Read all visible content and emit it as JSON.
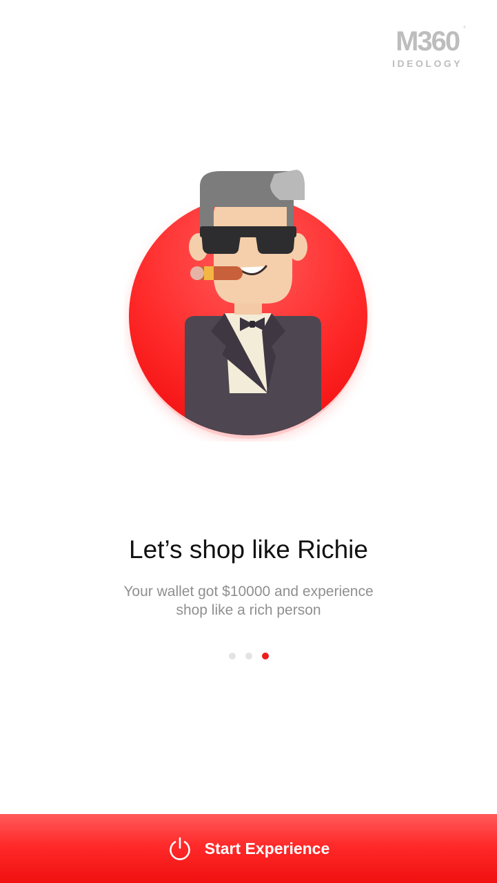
{
  "brand": {
    "logo_mark": "M360",
    "logo_registered": "°",
    "logo_sub": "IDEOLOGY"
  },
  "illustration": {
    "icon": "rich-man-avatar"
  },
  "onboarding": {
    "title": "Let’s shop like Richie",
    "subtitle": "Your wallet got $10000 and experience shop like a rich person",
    "page_indicator": {
      "total": 3,
      "current": 3
    }
  },
  "cta": {
    "label": "Start Experience",
    "icon": "power-icon"
  },
  "colors": {
    "accent": "#ff2a2a",
    "dot_inactive": "#e3e3e3",
    "dot_active": "#ee1c1c",
    "title": "#111111",
    "subtitle": "#8f8f8f",
    "logo": "#bdbdbd"
  }
}
